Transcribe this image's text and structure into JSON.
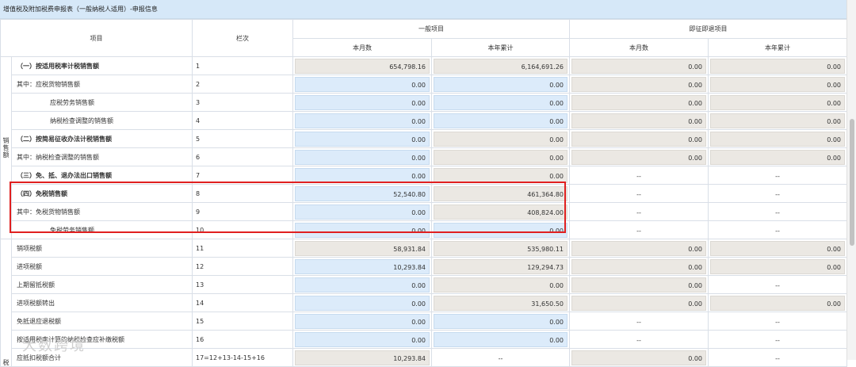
{
  "page": {
    "title": "增值税及附加税费申报表（一般纳税人适用）-申报信息"
  },
  "header": {
    "item": "项目",
    "col_no": "栏次",
    "general": "一般项目",
    "immediate": "即征即退项目",
    "month": "本月数",
    "year": "本年累计"
  },
  "groups": {
    "sales_label": "销售额",
    "tax_label": "税"
  },
  "rows": [
    {
      "label": "（一）按适用税率计税销售额",
      "no": "1",
      "v1": "654,798.16",
      "v2": "6,164,691.26",
      "v3": "0.00",
      "v4": "0.00"
    },
    {
      "label": "其中：应税货物销售额",
      "no": "2",
      "v1": "0.00",
      "v2": "0.00",
      "v3": "0.00",
      "v4": "0.00"
    },
    {
      "label": "应税劳务销售额",
      "no": "3",
      "v1": "0.00",
      "v2": "0.00",
      "v3": "0.00",
      "v4": "0.00"
    },
    {
      "label": "纳税检查调整的销售额",
      "no": "4",
      "v1": "0.00",
      "v2": "0.00",
      "v3": "0.00",
      "v4": "0.00"
    },
    {
      "label": "（二）按简易征收办法计税销售额",
      "no": "5",
      "v1": "0.00",
      "v2": "0.00",
      "v3": "0.00",
      "v4": "0.00"
    },
    {
      "label": "其中：纳税检查调整的销售额",
      "no": "6",
      "v1": "0.00",
      "v2": "0.00",
      "v3": "0.00",
      "v4": "0.00"
    },
    {
      "label": "（三）免、抵、退办法出口销售额",
      "no": "7",
      "v1": "0.00",
      "v2": "0.00",
      "v3": "--",
      "v4": "--"
    },
    {
      "label": "（四）免税销售额",
      "no": "8",
      "v1": "52,540.80",
      "v2": "461,364.80",
      "v3": "--",
      "v4": "--"
    },
    {
      "label": "其中：免税货物销售额",
      "no": "9",
      "v1": "0.00",
      "v2": "408,824.00",
      "v3": "--",
      "v4": "--"
    },
    {
      "label": "免税劳务销售额",
      "no": "10",
      "v1": "0.00",
      "v2": "0.00",
      "v3": "--",
      "v4": "--"
    },
    {
      "label": "销项税额",
      "no": "11",
      "v1": "58,931.84",
      "v2": "535,980.11",
      "v3": "0.00",
      "v4": "0.00"
    },
    {
      "label": "进项税额",
      "no": "12",
      "v1": "10,293.84",
      "v2": "129,294.73",
      "v3": "0.00",
      "v4": "0.00"
    },
    {
      "label": "上期留抵税额",
      "no": "13",
      "v1": "0.00",
      "v2": "0.00",
      "v3": "0.00",
      "v4": "--"
    },
    {
      "label": "进项税额转出",
      "no": "14",
      "v1": "0.00",
      "v2": "31,650.50",
      "v3": "0.00",
      "v4": "0.00"
    },
    {
      "label": "免抵退应退税额",
      "no": "15",
      "v1": "0.00",
      "v2": "0.00",
      "v3": "--",
      "v4": "--"
    },
    {
      "label": "按适用税率计算的纳税检查应补缴税额",
      "no": "16",
      "v1": "0.00",
      "v2": "0.00",
      "v3": "--",
      "v4": "--"
    },
    {
      "label": "应抵扣税额合计",
      "no": "17=12+13-14-15+16",
      "v1": "10,293.84",
      "v2": "--",
      "v3": "0.00",
      "v4": "--"
    }
  ],
  "watermark": "大数跨境"
}
